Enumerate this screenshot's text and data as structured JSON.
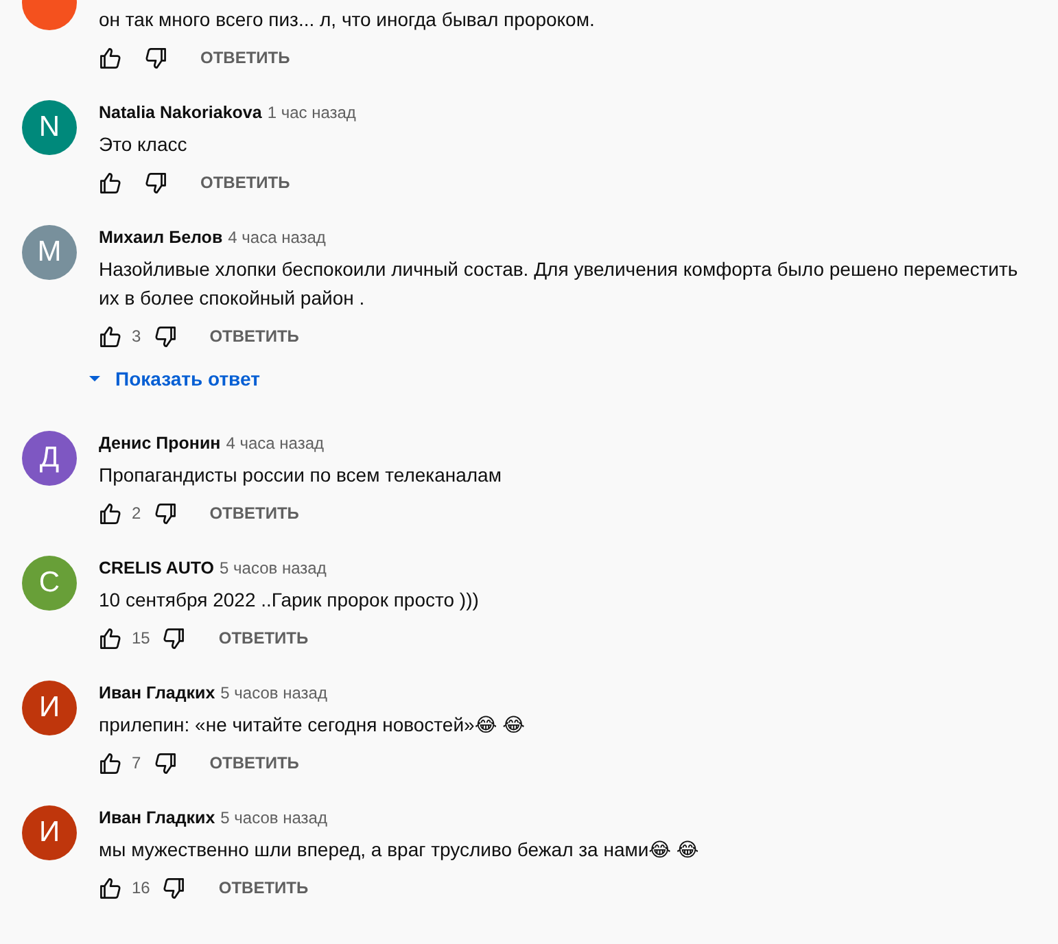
{
  "comments": [
    {
      "color": "#f4511e",
      "text": "он так много всего пиз... л, что иногда бывал пророком.",
      "reply_label": "ОТВЕТИТЬ"
    },
    {
      "avatar_letter": "N",
      "color": "#00897b",
      "author": "Natalia Nakoriakova",
      "time": "1 час назад",
      "text": "Это класс",
      "reply_label": "ОТВЕТИТЬ"
    },
    {
      "avatar_letter": "М",
      "color": "#78909c",
      "author": "Михаил Белов",
      "time": "4 часа назад",
      "text": "Назойливые хлопки беспокоили личный состав. Для увеличения комфорта было решено переместить их в более спокойный район .",
      "likes": "3",
      "reply_label": "ОТВЕТИТЬ",
      "replies_toggle": "Показать ответ"
    },
    {
      "avatar_letter": "Д",
      "color": "#7e57c2",
      "author": "Денис Пронин",
      "time": "4 часа назад",
      "text": "Пропагандисты россии по всем телеканалам",
      "likes": "2",
      "reply_label": "ОТВЕТИТЬ"
    },
    {
      "avatar_letter": "C",
      "color": "#689f38",
      "author": "CRELIS AUTO",
      "time": "5 часов назад",
      "text": "10 сентября 2022 ..Гарик пророк просто )))",
      "likes": "15",
      "reply_label": "ОТВЕТИТЬ"
    },
    {
      "avatar_letter": "И",
      "color": "#bf360c",
      "author": "Иван Гладких",
      "time": "5 часов назад",
      "text": "прилепин: «не читайте сегодня новостей»😂 😂",
      "likes": "7",
      "reply_label": "ОТВЕТИТЬ"
    },
    {
      "avatar_letter": "И",
      "color": "#bf360c",
      "author": "Иван Гладких",
      "time": "5 часов назад",
      "text": "мы мужественно шли вперед, а враг трусливо бежал за нами😂 😂",
      "likes": "16",
      "reply_label": "ОТВЕТИТЬ"
    }
  ]
}
